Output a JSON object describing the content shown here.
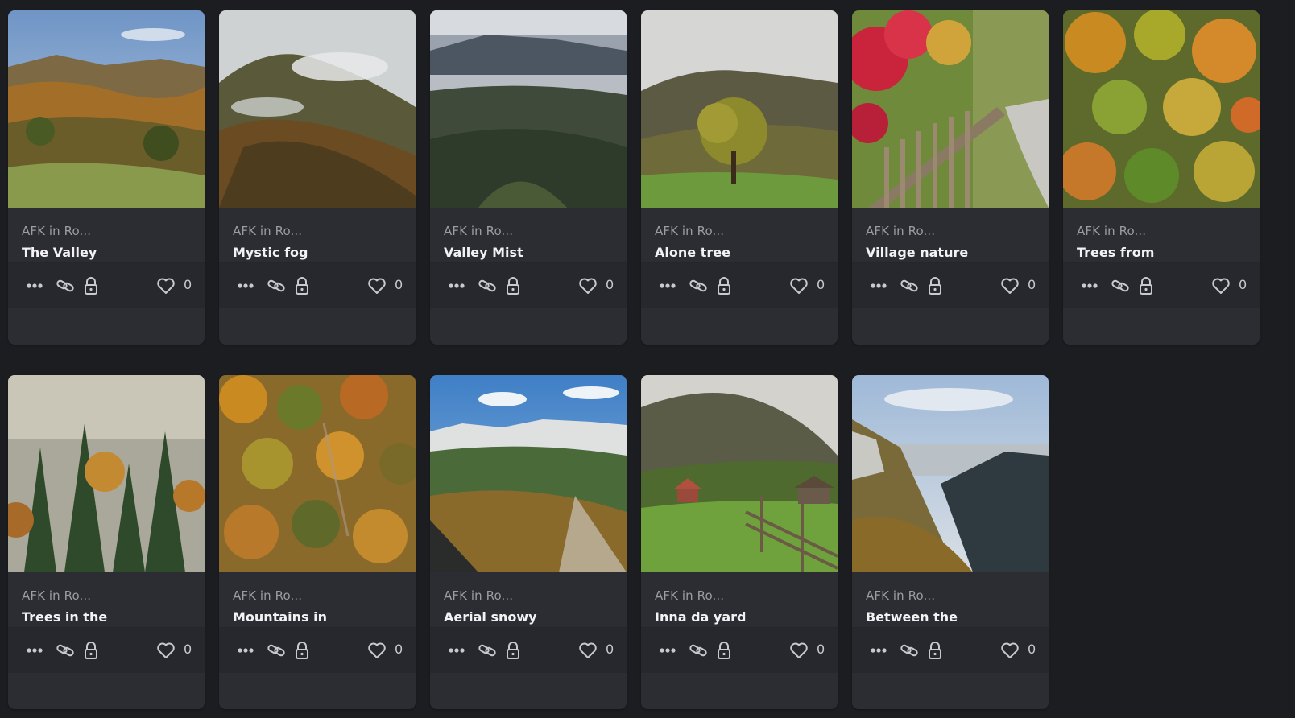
{
  "colors": {
    "background": "#1c1d21",
    "card": "#2c2d33",
    "footer": "#27282d",
    "muted_text": "#9c9da3",
    "title_text": "#f2f2f4"
  },
  "cards": [
    {
      "collection": "AFK in Ro...",
      "title": "The Valley",
      "likes": "0",
      "image": "autumn-valley-photo"
    },
    {
      "collection": "AFK in Ro...",
      "title": "Mystic fog",
      "likes": "0",
      "image": "foggy-forest-slope-photo"
    },
    {
      "collection": "AFK in Ro...",
      "title": "Valley Mist",
      "likes": "0",
      "image": "misty-mountain-valley-photo"
    },
    {
      "collection": "AFK in Ro...",
      "title": "Alone tree",
      "likes": "0",
      "image": "lone-tree-meadow-photo"
    },
    {
      "collection": "AFK in Ro...",
      "title": "Village nature",
      "likes": "0",
      "image": "red-leaves-fence-path-photo"
    },
    {
      "collection": "AFK in Ro...",
      "title": "Trees from above",
      "likes": "0",
      "image": "aerial-autumn-canopy-photo"
    },
    {
      "collection": "AFK in Ro...",
      "title": "Trees in the fog",
      "likes": "0",
      "image": "foggy-pine-forest-photo"
    },
    {
      "collection": "AFK in Ro...",
      "title": "Mountains in autumn fro...",
      "likes": "0",
      "image": "aerial-autumn-forest-photo"
    },
    {
      "collection": "AFK in Ro...",
      "title": "Aerial snowy mountains...",
      "likes": "0",
      "image": "snowy-ridge-aerial-photo"
    },
    {
      "collection": "AFK in Ro...",
      "title": "Inna da yard",
      "likes": "0",
      "image": "farmyard-fence-photo"
    },
    {
      "collection": "AFK in Ro...",
      "title": "Between the mountains",
      "likes": "0",
      "image": "mountain-gorge-view-photo"
    }
  ],
  "icons": {
    "more": "more-dots-icon",
    "link": "link-icon",
    "lock": "lock-icon",
    "like": "heart-icon"
  }
}
